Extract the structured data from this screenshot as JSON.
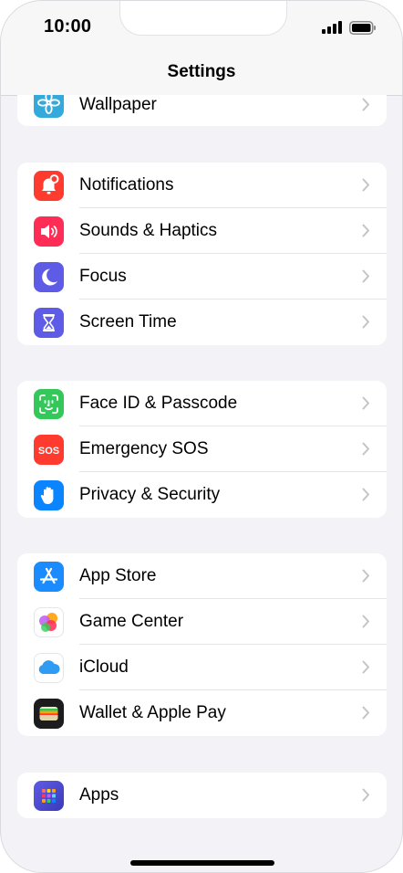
{
  "status_bar": {
    "time": "10:00"
  },
  "nav": {
    "title": "Settings"
  },
  "groups": [
    {
      "items": [
        {
          "label": "Wallpaper",
          "icon": "wallpaper-icon",
          "color": "#34aadc"
        }
      ]
    },
    {
      "items": [
        {
          "label": "Notifications",
          "icon": "notifications-icon",
          "color": "#ff3b30"
        },
        {
          "label": "Sounds & Haptics",
          "icon": "sounds-icon",
          "color": "#ff2d55"
        },
        {
          "label": "Focus",
          "icon": "focus-moon-icon",
          "color": "#5e5ce6"
        },
        {
          "label": "Screen Time",
          "icon": "hourglass-icon",
          "color": "#5e5ce6"
        }
      ]
    },
    {
      "items": [
        {
          "label": "Face ID & Passcode",
          "icon": "face-id-icon",
          "color": "#34c759"
        },
        {
          "label": "Emergency SOS",
          "icon": "sos-icon",
          "color": "#ff3b30",
          "icon_text": "SOS"
        },
        {
          "label": "Privacy & Security",
          "icon": "privacy-hand-icon",
          "color": "#0a84ff"
        }
      ]
    },
    {
      "items": [
        {
          "label": "App Store",
          "icon": "app-store-icon",
          "color": "#1a8cff"
        },
        {
          "label": "Game Center",
          "icon": "game-center-icon",
          "color": "#ffffff"
        },
        {
          "label": "iCloud",
          "icon": "icloud-icon",
          "color": "#ffffff"
        },
        {
          "label": "Wallet & Apple Pay",
          "icon": "wallet-icon",
          "color": "#1c1c1e"
        }
      ]
    },
    {
      "items": [
        {
          "label": "Apps",
          "icon": "apps-grid-icon",
          "color": "#5856d6"
        }
      ]
    }
  ]
}
